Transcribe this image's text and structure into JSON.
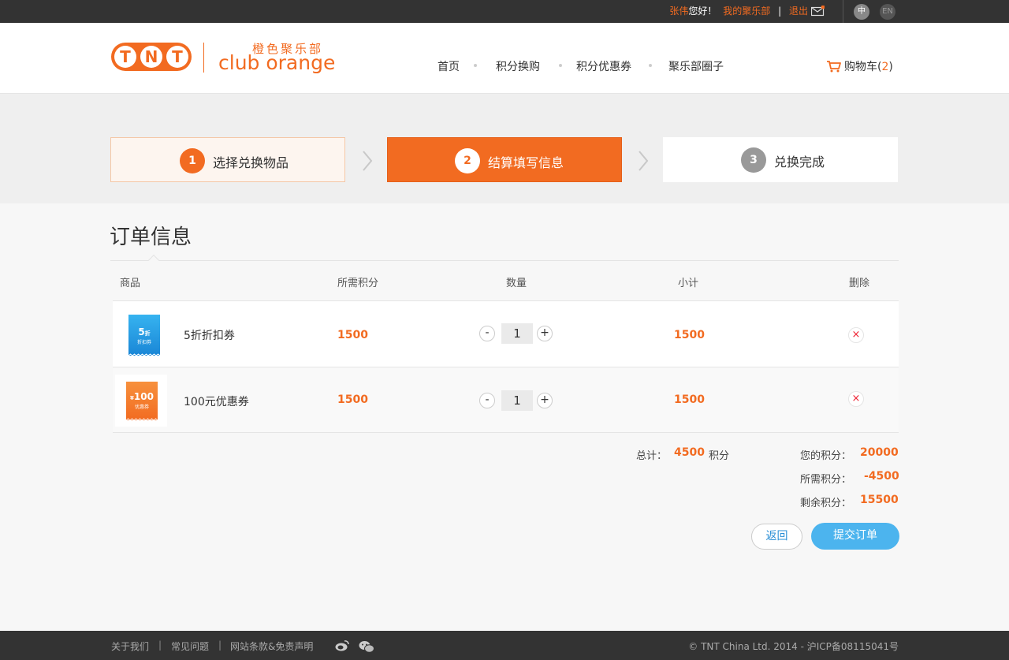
{
  "topbar": {
    "username": "张伟",
    "greeting": "您好！",
    "my_club": "我的聚乐部",
    "separator": "|",
    "logout": "退出",
    "lang_cn": "中",
    "lang_en": "EN"
  },
  "logo": {
    "brand": "TNT",
    "cn": "橙色聚乐部",
    "en": "club orange"
  },
  "nav": [
    "首页",
    "积分换购",
    "积分优惠券",
    "聚乐部圈子"
  ],
  "cart": {
    "label": "购物车",
    "open": "(",
    "count": "2",
    "close": ")"
  },
  "steps": [
    {
      "num": "1",
      "label": "选择兑换物品"
    },
    {
      "num": "2",
      "label": "结算填写信息"
    },
    {
      "num": "3",
      "label": "兑换完成"
    }
  ],
  "order": {
    "title": "订单信息",
    "headers": {
      "product": "商品",
      "points": "所需积分",
      "qty": "数量",
      "subtotal": "小计",
      "delete": "删除"
    },
    "items": [
      {
        "name": "5折折扣券",
        "points": "1500",
        "qty": "1",
        "subtotal": "1500",
        "thumb_big": "5",
        "thumb_unit": "折",
        "thumb_small": "折扣券"
      },
      {
        "name": "100元优惠券",
        "points": "1500",
        "qty": "1",
        "subtotal": "1500",
        "thumb_big": "100",
        "thumb_unit": "¥",
        "thumb_small": "优惠券"
      }
    ],
    "qty_minus": "-",
    "qty_plus": "+",
    "delete_icon": "×",
    "total_label": "总计：",
    "total_value": "4500",
    "total_unit": "积分",
    "your_points_label": "您的积分：",
    "your_points": "20000",
    "required_label": "所需积分：",
    "required": "-4500",
    "remaining_label": "剩余积分：",
    "remaining": "15500",
    "back": "返回",
    "submit": "提交订单"
  },
  "footer": {
    "links": [
      "关于我们",
      "常见问题",
      "网站条款&免责声明"
    ],
    "sep": "|",
    "copyright": "© TNT China Ltd. 2014 - 沪ICP备08115041号"
  },
  "colors": {
    "accent": "#f26b21",
    "blue": "#4cb4ee",
    "topbar": "#333333"
  },
  "icons": [
    "mail-icon",
    "cart-icon",
    "weibo-icon",
    "wechat-icon",
    "chevron-right-icon",
    "close-icon"
  ]
}
